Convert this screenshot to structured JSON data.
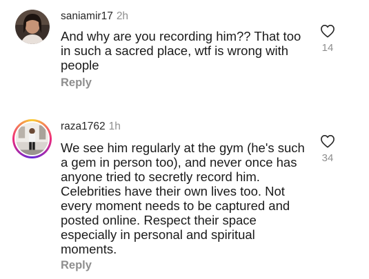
{
  "comments": [
    {
      "username": "saniamir17",
      "time": "2h",
      "text": "And why are you recording him?? That too in such a sacred place, wtf is wrong with people",
      "reply_label": "Reply",
      "likes": "14"
    },
    {
      "username": "raza1762",
      "time": "1h",
      "text": "We see him regularly at the gym (he's such a gem in person too), and never once has anyone tried to secretly record him. Celebrities have their own lives too. Not every moment needs to be captured and posted online. Respect their space especially in personal and spiritual moments.",
      "reply_label": "Reply",
      "likes": "34"
    }
  ],
  "icons": {
    "like": "heart-outline-icon"
  },
  "colors": {
    "text": "#262626",
    "muted": "#8e8e8e",
    "story_ring_start": "#f9ce34",
    "story_ring_mid": "#ee2a7b",
    "story_ring_end": "#6228d7"
  }
}
